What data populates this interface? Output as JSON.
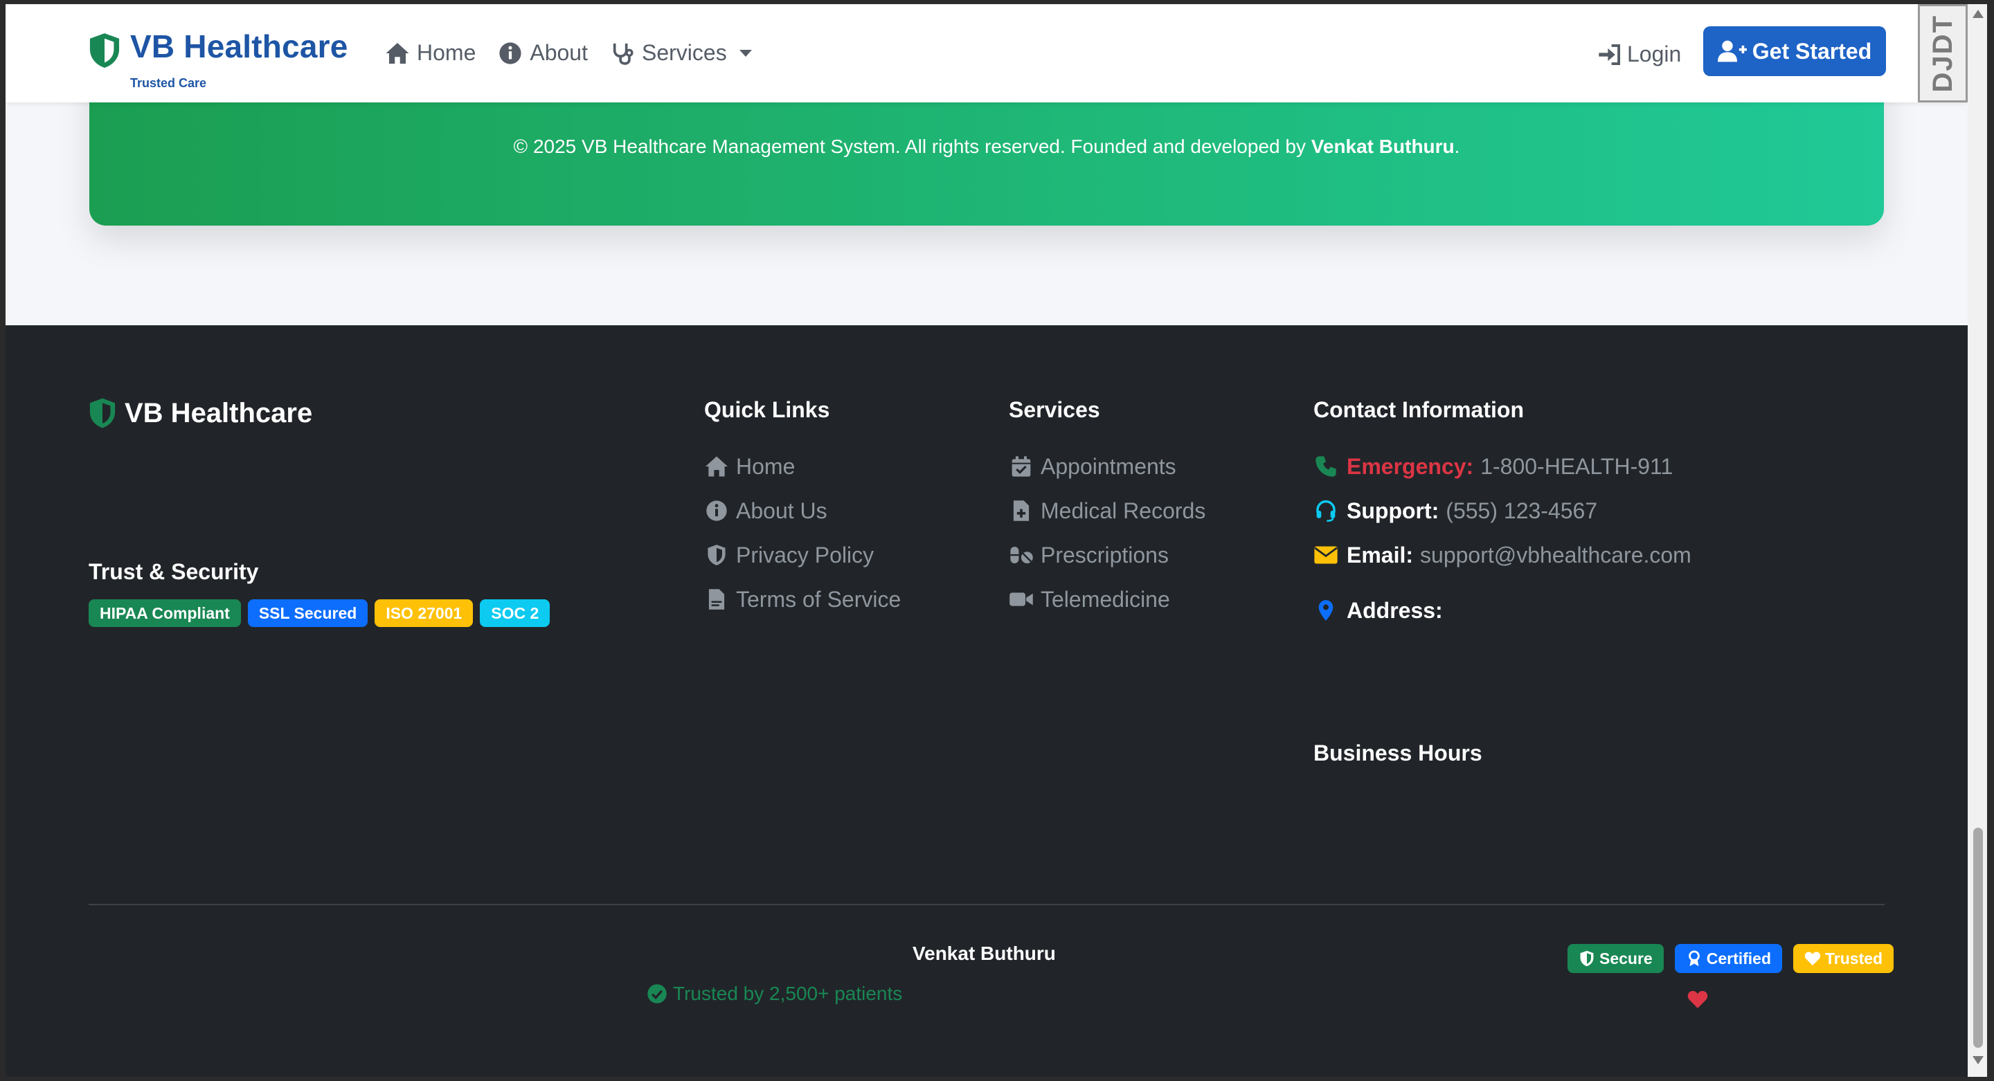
{
  "navbar": {
    "brand_title": "VB Healthcare",
    "brand_subtitle": "Trusted Care",
    "items": [
      {
        "label": "Home",
        "icon": "home-icon"
      },
      {
        "label": "About",
        "icon": "info-circle-icon"
      },
      {
        "label": "Services",
        "icon": "stethoscope-icon"
      }
    ],
    "login_label": "Login",
    "cta_label": "Get Started",
    "side_badge": "DJDT"
  },
  "banner": {
    "copyright_prefix": "© 2025 VB Healthcare Management System. All rights reserved. Founded and developed by ",
    "founder": "Venkat Buthuru",
    "copyright_suffix": "."
  },
  "footer": {
    "brand": "VB Healthcare",
    "trust_title": "Trust & Security",
    "trust_badges": [
      {
        "label": "HIPAA Compliant",
        "color": "#198754",
        "text": "#ffffff"
      },
      {
        "label": "SSL Secured",
        "color": "#0d6efd",
        "text": "#ffffff"
      },
      {
        "label": "ISO 27001",
        "color": "#ffc107",
        "text": "#ffffff"
      },
      {
        "label": "SOC 2",
        "color": "#0dcaf0",
        "text": "#ffffff"
      }
    ],
    "quick_links": {
      "title": "Quick Links",
      "items": [
        "Home",
        "About Us",
        "Privacy Policy",
        "Terms of Service"
      ]
    },
    "services": {
      "title": "Services",
      "items": [
        "Appointments",
        "Medical Records",
        "Prescriptions",
        "Telemedicine"
      ]
    },
    "contact": {
      "title": "Contact Information",
      "emergency_label": "Emergency:",
      "emergency_value": "1-800-HEALTH-911",
      "support_label": "Support:",
      "support_value": "(555) 123-4567",
      "email_label": "Email:",
      "email_value": "support@vbhealthcare.com",
      "address_label": "Address:",
      "hours_title": "Business Hours"
    },
    "developer": "Venkat Buthuru",
    "trusted_text": "Trusted by 2,500+ patients",
    "bottom_badges": [
      {
        "label": "Secure",
        "color": "#198754"
      },
      {
        "label": "Certified",
        "color": "#0d6efd"
      },
      {
        "label": "Trusted",
        "color": "#ffc107"
      }
    ]
  },
  "colors": {
    "brand_blue": "#1e55a5",
    "brand_green": "#198754",
    "danger": "#dc3545",
    "footer_bg": "#212529"
  }
}
